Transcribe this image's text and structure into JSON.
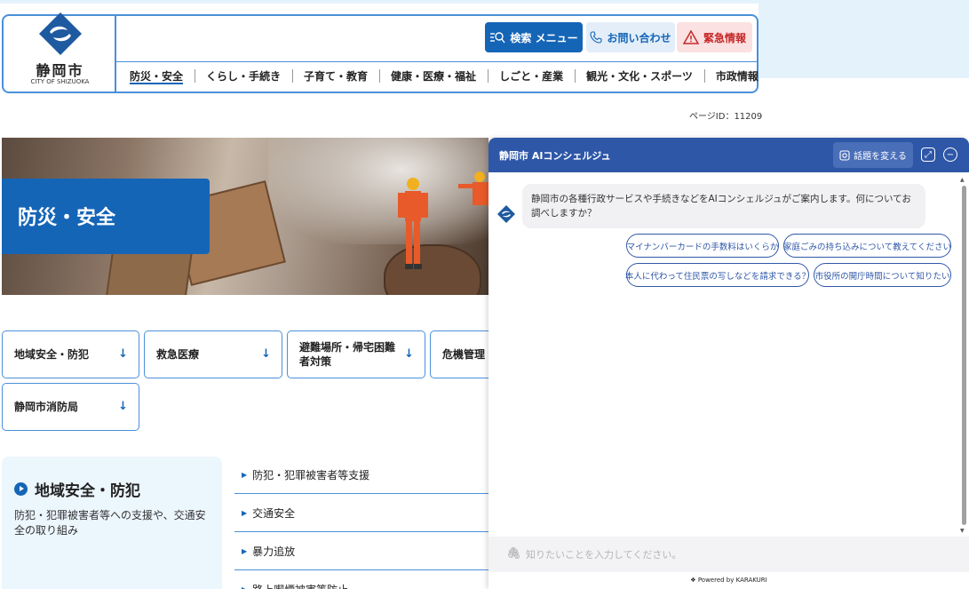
{
  "header": {
    "logo_jp": "静岡市",
    "logo_en": "CITY OF SHIZUOKA",
    "search_menu_label": "検索 メニュー",
    "contact_label": "お問い合わせ",
    "emergency_label": "緊急情報",
    "nav": [
      "防災・安全",
      "くらし・手続き",
      "子育て・教育",
      "健康・医療・福祉",
      "しごと・産業",
      "観光・文化・スポーツ",
      "市政情報"
    ],
    "nav_active": 0
  },
  "page_id": "ページID：11209",
  "hero": {
    "title": "防災・安全"
  },
  "categories": [
    {
      "label": "地域安全・防犯"
    },
    {
      "label": "救急医療"
    },
    {
      "label": "避難場所・帰宅困難者対策"
    },
    {
      "label": "危機管理"
    },
    {
      "label": "静岡市消防局"
    }
  ],
  "section": {
    "title": "地域安全・防犯",
    "description": "防犯・犯罪被害者等への支援や、交通安全の取り組み",
    "links": [
      "防犯・犯罪被害者等支援",
      "交通安全",
      "暴力追放",
      "路上喫煙被害等防止"
    ]
  },
  "chat": {
    "title": "静岡市 AIコンシェルジュ",
    "topic_button": "話題を変える",
    "bot_message": "静岡市の各種行政サービスや手続きなどをAIコンシェルジュがご案内します。何についてお調べしますか？",
    "suggestions": [
      "マイナンバーカードの手数料はいくらか",
      "家庭ごみの持ち込みについて教えてください",
      "本人に代わって住民票の写しなどを請求できる？",
      "市役所の開庁時間について知りたい"
    ],
    "input_placeholder": "知りたいことを入力してください。",
    "powered_by": "Powered by KARAKURI"
  },
  "colors": {
    "primary": "#1565b7",
    "chat_header": "#2f57a8",
    "emergency": "#c62828",
    "light_bg": "#e4f3fb"
  }
}
